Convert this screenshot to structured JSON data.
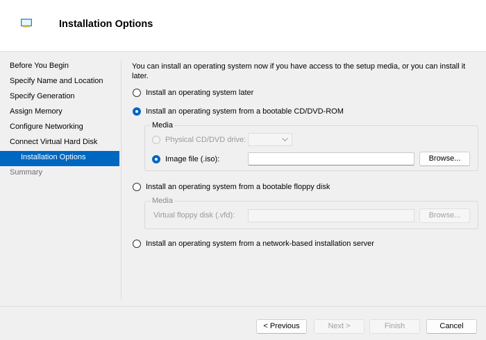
{
  "header": {
    "title": "Installation Options",
    "icon": "wizard-icon"
  },
  "nav": {
    "items": [
      {
        "label": "Before You Begin"
      },
      {
        "label": "Specify Name and Location"
      },
      {
        "label": "Specify Generation"
      },
      {
        "label": "Assign Memory"
      },
      {
        "label": "Configure Networking"
      },
      {
        "label": "Connect Virtual Hard Disk"
      },
      {
        "label": "Installation Options"
      },
      {
        "label": "Summary"
      }
    ],
    "selected": "Installation Options",
    "selected_color": "#0067c0"
  },
  "main": {
    "description": "You can install an operating system now if you have access to the setup media, or you can install it later.",
    "option_later": "Install an operating system later",
    "option_cd": "Install an operating system from a bootable CD/DVD-ROM",
    "cd_media": {
      "legend": "Media",
      "physical_label": "Physical CD/DVD drive:",
      "image_label": "Image file (.iso):",
      "image_value": "",
      "browse": "Browse..."
    },
    "option_floppy": "Install an operating system from a bootable floppy disk",
    "floppy_media": {
      "legend": "Media",
      "vfd_label": "Virtual floppy disk (.vfd):",
      "vfd_value": "",
      "browse": "Browse..."
    },
    "option_network": "Install an operating system from a network-based installation server",
    "selected_option": "cd",
    "selected_cd_source": "image"
  },
  "footer": {
    "previous": "< Previous",
    "next": "Next >",
    "finish": "Finish",
    "cancel": "Cancel"
  }
}
